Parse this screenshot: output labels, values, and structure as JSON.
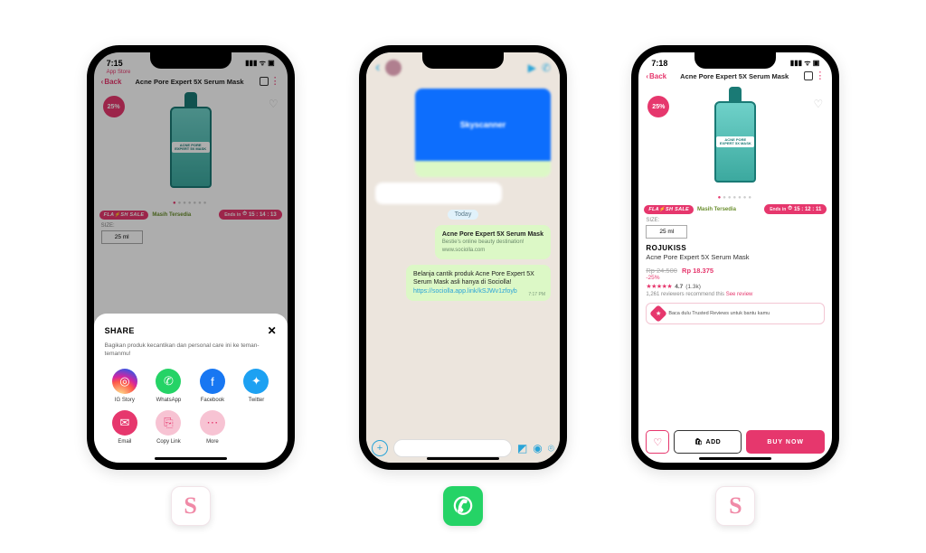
{
  "phones": {
    "share": {
      "status_time": "7:15",
      "status_app": "App Store",
      "back": "Back",
      "title": "Acne Pore Expert 5X Serum Mask",
      "discount_badge": "25%",
      "bottle_label": "ACNE PORE EXPERT 5X MASK",
      "flash_label": "FLA⚡SH SALE",
      "flash_stock": "Masih Tersedia",
      "flash_ends": "Ends in",
      "flash_timer": "15 : 14 : 13",
      "size_label": "SIZE:",
      "size_value": "25 ml",
      "sheet": {
        "title": "SHARE",
        "subtitle": "Bagikan produk kecantikan dan personal care ini ke teman-temanmu!",
        "items": [
          {
            "label": "IG Story",
            "icon": "◎",
            "cls": "ic-ig"
          },
          {
            "label": "WhatsApp",
            "icon": "✆",
            "cls": "ic-wa"
          },
          {
            "label": "Facebook",
            "icon": "f",
            "cls": "ic-fb"
          },
          {
            "label": "Twitter",
            "icon": "✦",
            "cls": "ic-tw"
          },
          {
            "label": "Email",
            "icon": "✉",
            "cls": "ic-em"
          },
          {
            "label": "Copy Link",
            "icon": "⎘",
            "cls": "ic-cl"
          },
          {
            "label": "More",
            "icon": "⋯",
            "cls": "ic-more"
          }
        ]
      }
    },
    "whatsapp": {
      "card_brand": "Skyscanner",
      "date_pill": "Today",
      "msg1_title": "Acne Pore Expert 5X Serum Mask",
      "msg1_sub": "Bestie's online beauty destination!",
      "msg1_domain": "www.sociolla.com",
      "msg2_text": "Belanja cantik produk Acne Pore Expert 5X Serum Mask asli hanya di Sociolla!",
      "msg2_link": "https://sociolla.app.link/kSJWv1zfoyb",
      "msg_time": "7:17 PM"
    },
    "detail": {
      "status_time": "7:18",
      "back": "Back",
      "title": "Acne Pore Expert 5X Serum Mask",
      "discount_badge": "25%",
      "bottle_label": "ACNE PORE EXPERT 5X MASK",
      "flash_label": "FLA⚡SH SALE",
      "flash_stock": "Masih Tersedia",
      "flash_ends": "Ends in",
      "flash_timer": "15 : 12 : 11",
      "size_label": "SIZE:",
      "size_value": "25 ml",
      "brand": "ROJUKISS",
      "product_name": "Acne Pore Expert 5X Serum Mask",
      "price_old": "Rp 24.500",
      "price_new": "Rp 18.375",
      "discount_text": "-25%",
      "rating_value": "4.7",
      "rating_count": "(1.3k)",
      "recommend_text": "1,261 reviewers recommend this",
      "see_review": "See review",
      "trusted_text": "Baca dulu Trusted Reviews untuk bantu kamu",
      "add_label": "ADD",
      "buy_label": "BUY NOW"
    }
  },
  "badges": {
    "s": "S",
    "wa": "✆"
  }
}
